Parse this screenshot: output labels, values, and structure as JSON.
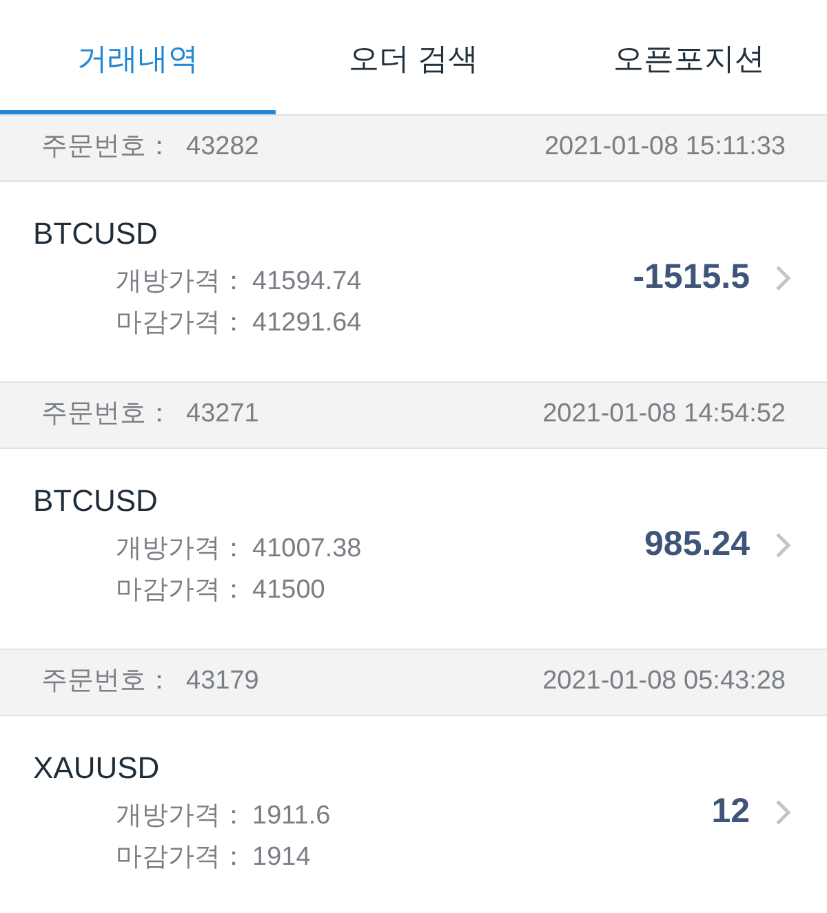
{
  "tabs": [
    {
      "label": "거래내역",
      "selected": true
    },
    {
      "label": "오더 검색",
      "selected": false
    },
    {
      "label": "오픈포지션",
      "selected": false
    }
  ],
  "orders": [
    {
      "order_label": "주문번호：",
      "order_no": "43282",
      "time": "2021-01-08 15:11:33",
      "symbol": "BTCUSD",
      "open_label": "개방가격：",
      "open_price": "41594.74",
      "close_label": "마감가격：",
      "close_price": "41291.64",
      "profit": "-1515.5"
    },
    {
      "order_label": "주문번호：",
      "order_no": "43271",
      "time": "2021-01-08 14:54:52",
      "symbol": "BTCUSD",
      "open_label": "개방가격：",
      "open_price": "41007.38",
      "close_label": "마감가격：",
      "close_price": "41500",
      "profit": "985.24"
    },
    {
      "order_label": "주문번호：",
      "order_no": "43179",
      "time": "2021-01-08 05:43:28",
      "symbol": "XAUUSD",
      "open_label": "개방가격：",
      "open_price": "1911.6",
      "close_label": "마감가격：",
      "close_price": "1914",
      "profit": "12"
    }
  ]
}
